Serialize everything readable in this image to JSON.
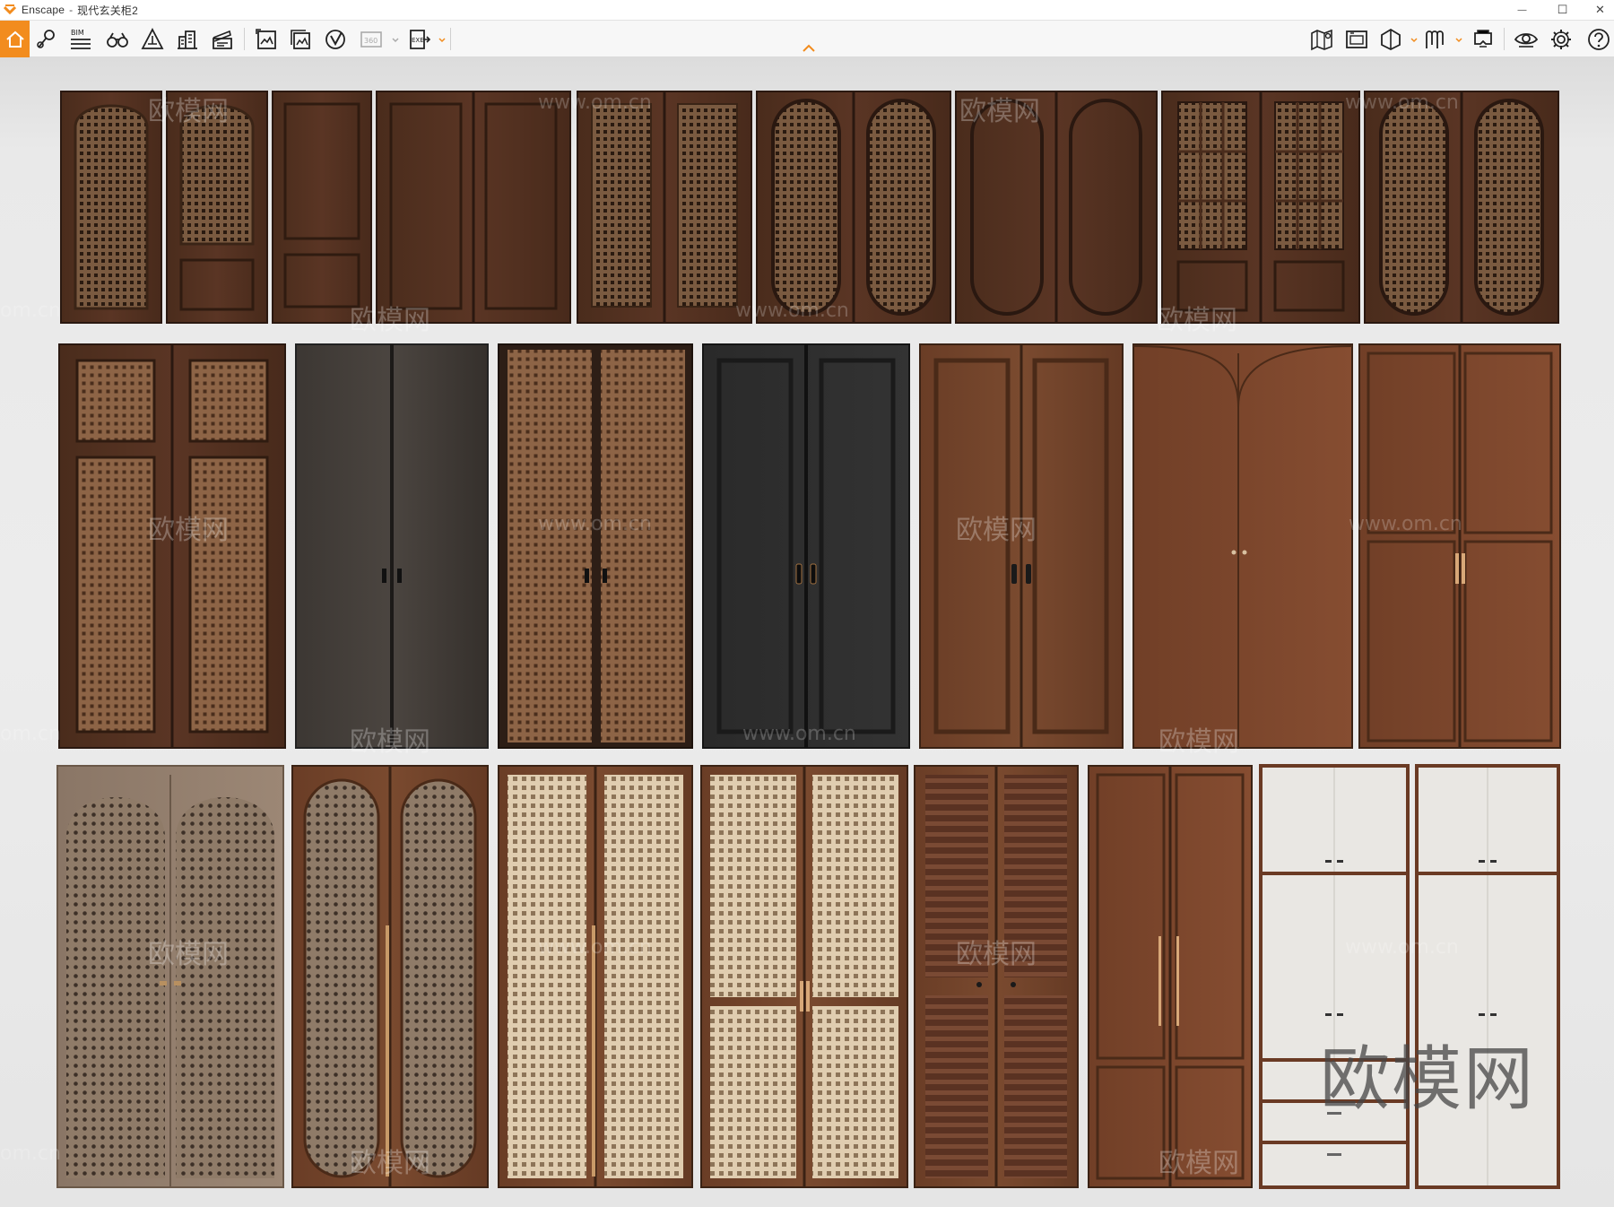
{
  "window": {
    "app_name": "Enscape",
    "separator": "-",
    "document_name": "现代玄关柜2",
    "controls": {
      "minimize": "—",
      "maximize": "☐",
      "close": "✕"
    }
  },
  "toolbar": {
    "accent_color": "#f28c1e",
    "left_tools": [
      {
        "name": "home-icon",
        "active": true
      },
      {
        "name": "views-icon"
      },
      {
        "name": "bim-icon",
        "label": "BIM"
      },
      {
        "name": "binoculars-icon"
      },
      {
        "name": "asset-library-icon"
      },
      {
        "name": "buildings-icon"
      },
      {
        "name": "clapperboard-icon"
      },
      {
        "name": "render-image-icon"
      },
      {
        "name": "batch-render-icon"
      },
      {
        "name": "video-render-icon"
      },
      {
        "name": "panorama-icon",
        "label": "360",
        "disabled": true
      },
      {
        "name": "export-exe-icon",
        "label": "EXE"
      }
    ],
    "right_tools": [
      {
        "name": "map-icon"
      },
      {
        "name": "visual-settings-icon"
      },
      {
        "name": "cube-section-icon"
      },
      {
        "name": "materials-icon"
      },
      {
        "name": "vr-headset-icon"
      },
      {
        "name": "eye-icon"
      },
      {
        "name": "settings-gear-icon"
      },
      {
        "name": "help-icon"
      }
    ]
  },
  "viewport": {
    "scene": "wardrobe doors catalog",
    "watermark_text": "欧模网",
    "watermark_url": "www.om.cn",
    "watermark_url_short": "om.cn",
    "logo_text": "欧模网"
  }
}
